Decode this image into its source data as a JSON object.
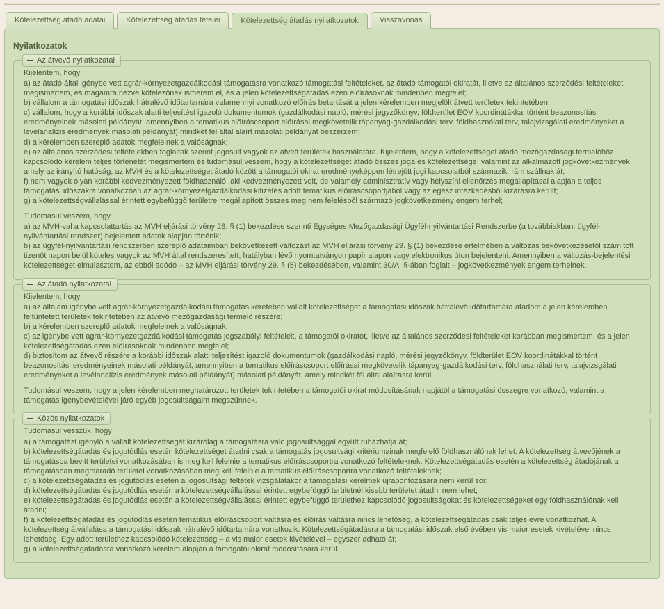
{
  "tabs": [
    {
      "label": "Kötelezettség átadó adatai"
    },
    {
      "label": "Kötelezettség átadás tételei"
    },
    {
      "label": "Kötelezettség átadás nyilatkozatok"
    },
    {
      "label": "Visszavonás"
    }
  ],
  "panel_title": "Nyilatkozatok",
  "sec1": {
    "legend": "Az átvevő nyilatkozatai",
    "lead1": "Kijelentem, hogy",
    "a": "a) az átadó által igénybe vett agrár-környezetgazdálkodási támogatásra vonatkozó támogatási feltételeket, az átadó támogatói okiratát, illetve az általános szerződési feltételeket megismertem, és magamra nézve kötelezőnek ismerem el, és a jelen kötelezettségátadás ezen előírásoknak mindenben megfelel;",
    "b": "b) vállalom a támogatási időszak hátralévő időtartamára valamennyi vonatkozó előírás betartását a jelen kérelemben megjelölt átvett területek tekintetében;",
    "c": "c) vállalom, hogy a korábbi időszak alatti teljesítést igazoló dokumentumok (gazdálkodási napló, mérési jegyzőkönyv, földterület EOV koordinátákkal történt beazonosítási eredményeinek másolati példányát, amennyiben a tematikus előíráscsoport előírásai megkövetelik tápanyag-gazdálkodási terv, földhasználati terv, talajvizsgálati eredményeket a levélanalízis eredmények másolati példányát) mindkét fél által aláírt másolati példányát beszerzem;",
    "d": "d) a kérelemben szereplő adatok megfelelnek a valóságnak;",
    "e": "e) az általános szerződési feltételekben foglaltak szerint jogosult vagyok az átvett területek használatára. Kijelentem, hogy a kötelezettséget átadó mezőgazdasági termelőhöz kapcsolódó kérelem teljes történetét megismertem és tudomásul veszem, hogy a kötelezettséget átadó összes joga és kötelezettsége, valamint az alkalmazott jogkövetkezmények, amely az irányító hatóság, az MVH és a kötelezettséget átadó között a támogatói okirat eredményeképpen létrejött jogi kapcsolatból származik, rám szállnak át;",
    "f": "f) nem vagyok olyan korábbi kedvezményezett földhasználó, aki kedvezményezett volt, de valamely adminisztratív vagy helyszíni ellenőrzés megállapításai alapján a teljes támogatási időszakra vonatkozóan az agrár-környezetgazdálkodási kifizetés adott tematikus előíráscsoportjából vagy az egész intézkedésből kizárásra került;",
    "g": "g) a kötelezettségvállalással érintett egybefüggő területre megállapított összes meg nem felelésből származó jogkövetkezmény engem terhel;",
    "lead2": "Tudomásul veszem, hogy",
    "a2": "a) az MVH-val a kapcsolattartás az MVH eljárási törvény 28. § (1) bekezdése szerinti Egységes Mezőgazdasági Ügyfél-nyilvántartási Rendszerbe (a továbbiakban: ügyfél-nyilvántartási rendszer) bejelentett adatok alapján történik;",
    "b2": "b) az ügyfél-nyilvántartási rendszerben szereplő adataimban bekövetkezett változást az MVH eljárási törvény 29. § (1) bekezdése értelmében a változás bekövetkezésétől számított tizenöt napon belül köteles vagyok az MVH által rendszeresített, hatályban lévő nyomtatványon papír alapon vagy elektronikus úton bejelenteni. Amennyiben a változás-bejelentési kötelezettséget elmulasztom, az ebből adódó – az MVH eljárási törvény 29. § (5) bekezdésében, valamint 30/A. §-ában foglalt – jogkövetkezmények engem terhelnek."
  },
  "sec2": {
    "legend": "Az átadó nyilatkozatai",
    "lead1": "Kijelentem, hogy",
    "a": "a) az általam igénybe vett agrár-környezetgazdálkodási támogatás keretében vállalt kötelezettséget a támogatási időszak hátralévő időtartamára átadom a jelen kérelemben feltüntetett területek tekintetében az átvevő mezőgazdasági termelő részére;",
    "b": "b) a kérelemben szereplő adatok megfelelnek a valóságnak;",
    "c": "c) az igénybe vett agrár-környezetgazdálkodási támogatás jogszabályi feltételeit, a támogatói okiratot, illetve az általános szerződési feltételeket korábban megismertem, és a jelen kötelezettségátadás ezen előírásoknak mindenben megfelel;",
    "d": "d) biztosítom az átvevő részére a korábbi időszak alatti teljesítést igazoló dokumentumok (gazdálkodási napló, mérési jegyzőkönyv, földterület EOV koordinátákkal történt beazonosítási eredményeinek másolati példányát, amennyiben a tematikus előíráscsoport előírásai megkövetelik tápanyag-gazdálkodási terv, földhasználati terv, talajvizsgálati eredményeket a levélanalízis eredmények másolati példányát) másolati példányát, amely mindkét fél által aláírásra kerül.",
    "lead2": "Tudomásul veszem, hogy a jelen kérelemben meghatározott területek tekintetében a támogatói okirat módosításának napjától a támogatási összegre vonatkozó, valamint a támogatás igénybevételével járó egyéb jogosultságaim megszűnnek."
  },
  "sec3": {
    "legend": "Közös nyilatkozatok",
    "lead1": "Tudomásul vesszük, hogy",
    "a": "a) a támogatást igénylő a vállalt kötelezettségét kizárólag a támogatásra való jogosultsággal együtt ruházhatja át;",
    "b": "b) kötelezettségátadás és jogutódlás esetén kötelezettséget átadni csak a támogatás jogosultsági kritériumainak megfelelő földhasználónak lehet. A kötelezettség átvevőjének a támogatásba bevitt területei vonatkozásában is meg kell felelnie a tematikus előíráscsoportra vonatkozó feltételeknek. Kötelezettségátadás esetén a kötelezettség átadójának a támogatásban megmaradó területei vonatkozásában meg kell felelnie a tematikus előíráscsoportra vonatkozó feltételeknek;",
    "c": "c) a kötelezettségátadás és jogutódlás esetén a jogosultsági feltétek vizsgálatakor a támogatási kérelmek újrapontozására nem kerül sor;",
    "d": "d) kötelezettségátadás és jogutódlás esetén a kötelezettségvállalással érintett egybefüggő területnél kisebb területet átadni nem lehet;",
    "e": "e) kötelezettségátadás és jogutódlás esetén a kötelezettségvállalással érintett egybefüggő területhez kapcsolódó jogosultságokat és kötelezettségeket egy földhasználónak kell átadni;",
    "f": "f) a kötelezettségátadás és jogutódlás esetén tematikus előíráscsoport váltásra és előírás váltásra nincs lehetőség, a kötelezettségátadás csak teljes évre vonatkozhat. A kötelezettség átvállalása a támogatási időszak hátralévő időtartamára vonatkozik. Kötelezettségátadásra a támogatási időszak első évében vis maior esetek kivételével nincs lehetőség. Egy adott területhez kapcsolódó kötelezettség – a vis maior esetek kivételével – egyszer adható át;",
    "g": "g) a kötelezettségátadásra vonatkozó kérelem alapján a támogatói okirat módosítására kerül."
  }
}
